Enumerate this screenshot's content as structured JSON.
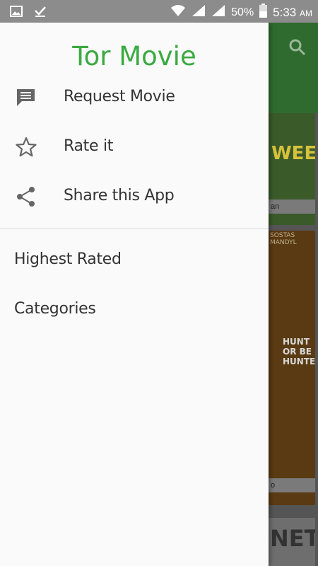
{
  "status_bar": {
    "battery": "50%",
    "time": "5:33",
    "ampm": "AM",
    "icons": [
      "gallery-icon",
      "download-done-icon",
      "wifi-icon",
      "signal-icon",
      "signal-icon",
      "battery-icon"
    ]
  },
  "drawer": {
    "title": "Tor Movie",
    "title_color": "#3aaa41",
    "items": [
      {
        "label": "Request Movie",
        "icon": "comment-icon"
      },
      {
        "label": "Rate it",
        "icon": "star-outline-icon"
      },
      {
        "label": "Share this App",
        "icon": "share-icon"
      }
    ],
    "sections": [
      {
        "label": "Highest Rated"
      },
      {
        "label": "Categories"
      }
    ]
  },
  "background": {
    "posters": [
      {
        "text": "WEED",
        "caption": "an"
      },
      {
        "text": "HUNT OR BE HUNTED",
        "top_text": "SOSTAS MANDYL",
        "caption": "o"
      },
      {
        "text": "NET"
      }
    ]
  }
}
